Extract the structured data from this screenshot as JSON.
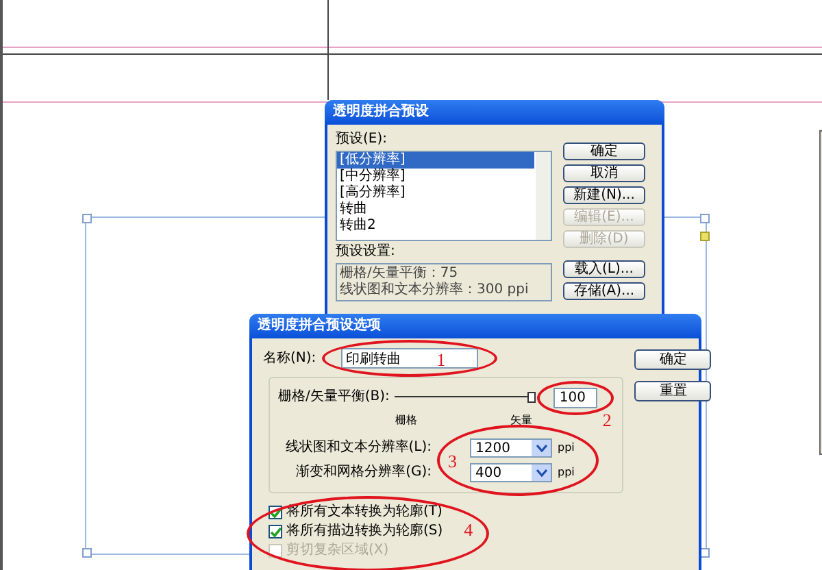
{
  "preset_dialog": {
    "title": "透明度拼合预设",
    "presets_label": "预设(E):",
    "presets": [
      {
        "label": "[低分辨率]",
        "selected": true
      },
      {
        "label": "[中分辨率]",
        "selected": false
      },
      {
        "label": "[高分辨率]",
        "selected": false
      },
      {
        "label": "转曲",
        "selected": false
      },
      {
        "label": "转曲2",
        "selected": false
      }
    ],
    "settings_label": "预设设置:",
    "settings_lines": [
      "栅格/矢量平衡：75",
      "线状图和文本分辨率：300 ppi"
    ],
    "buttons": [
      {
        "label": "确定",
        "disabled": false
      },
      {
        "label": "取消",
        "disabled": false
      },
      {
        "label": "新建(N)...",
        "disabled": false
      },
      {
        "label": "编辑(E)...",
        "disabled": true
      },
      {
        "label": "删除(D)",
        "disabled": true
      },
      {
        "label": "载入(L)...",
        "disabled": false
      },
      {
        "label": "存储(A)...",
        "disabled": false
      }
    ]
  },
  "options_dialog": {
    "title": "透明度拼合预设选项",
    "name_label": "名称(N):",
    "name_value": "印刷转曲",
    "buttons": [
      "确定",
      "重置"
    ],
    "balance": {
      "label": "栅格/矢量平衡(B):",
      "level": 1,
      "value": "100",
      "min_label": "栅格",
      "max_label": "矢量"
    },
    "resolutions": [
      {
        "label": "线状图和文本分辨率(L):",
        "value": "1200",
        "unit": "ppi"
      },
      {
        "label": "渐变和网格分辨率(G):",
        "value": "400",
        "unit": "ppi"
      }
    ],
    "checkboxes": [
      {
        "label": "将所有文本转换为轮廓(T)",
        "checked": true,
        "disabled": false
      },
      {
        "label": "将所有描边转换为轮廓(S)",
        "checked": true,
        "disabled": false
      },
      {
        "label": "剪切复杂区域(X)",
        "checked": false,
        "disabled": true
      }
    ]
  },
  "annotations": [
    {
      "number": "1"
    },
    {
      "number": "2"
    },
    {
      "number": "3"
    },
    {
      "number": "4"
    }
  ]
}
